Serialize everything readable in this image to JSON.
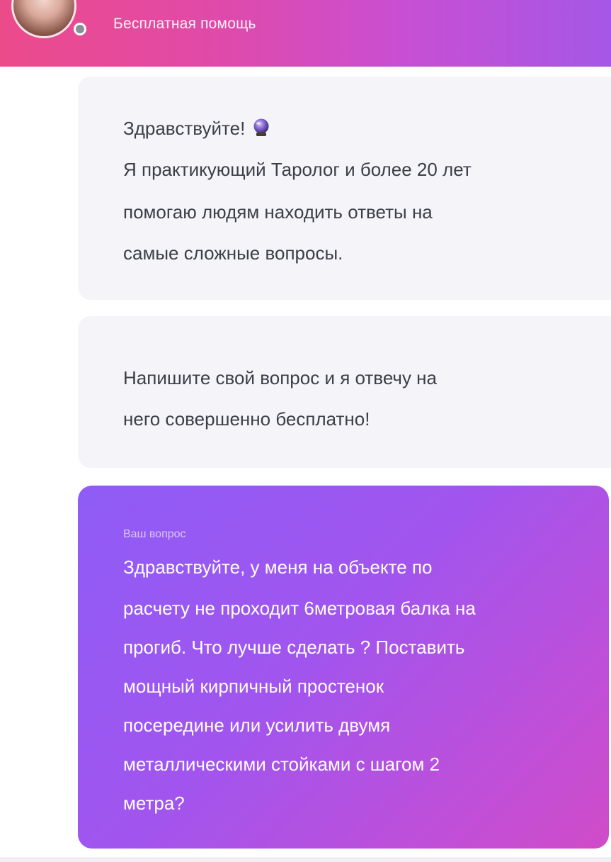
{
  "header": {
    "title": "Бесплатная помощь",
    "gradient_start": "#ec4b8a",
    "gradient_end": "#a557e6",
    "status": "online-dot"
  },
  "messages": {
    "greeting": {
      "lines": [
        "Здравствуйте!",
        "Я практикующий Таролог и более 20 лет",
        "помогаю людям находить ответы на",
        "самые сложные вопросы."
      ],
      "icon": "crystal-ball-icon"
    },
    "prompt": {
      "lines": [
        "Напишите свой вопрос и я отвечу на",
        "него совершенно бесплатно!"
      ]
    },
    "user_question": {
      "label": "Ваш вопрос",
      "lines": [
        "Здравствуйте, у меня на объекте по",
        "расчету не проходит 6метровая балка на",
        "прогиб. Что лучше сделать ? Поставить",
        "мощный кирпичный простенок",
        "посередине или усилить двумя",
        "металлическими стойками с шагом 2",
        "метра?"
      ],
      "bubble_color_start": "#8f5cf7",
      "bubble_color_end": "#d04cc8"
    }
  }
}
